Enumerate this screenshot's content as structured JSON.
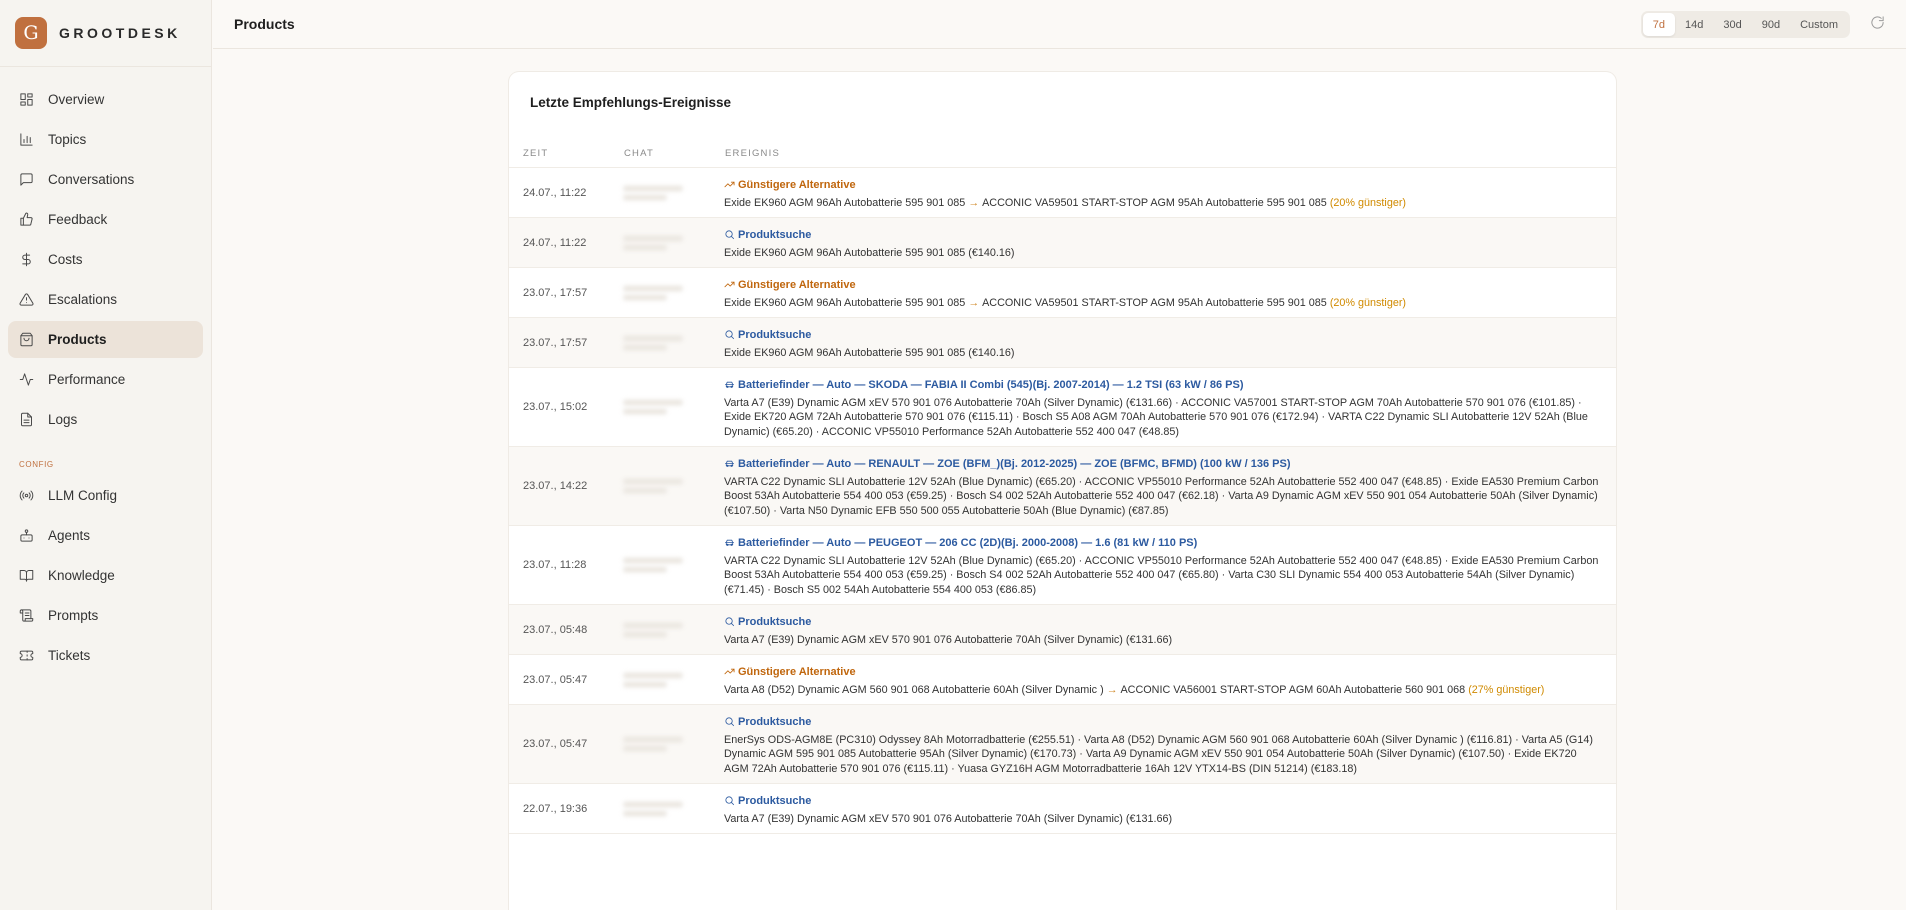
{
  "brand": {
    "logo_letter": "G",
    "name": "GROOTDESK"
  },
  "nav": {
    "items": [
      {
        "label": "Overview",
        "icon": "grid-icon",
        "active": false
      },
      {
        "label": "Topics",
        "icon": "bar-chart-icon",
        "active": false
      },
      {
        "label": "Conversations",
        "icon": "chat-bubble-icon",
        "active": false
      },
      {
        "label": "Feedback",
        "icon": "thumbs-up-icon",
        "active": false
      },
      {
        "label": "Costs",
        "icon": "dollar-icon",
        "active": false
      },
      {
        "label": "Escalations",
        "icon": "warning-icon",
        "active": false
      },
      {
        "label": "Products",
        "icon": "shopping-bag-icon",
        "active": true
      },
      {
        "label": "Performance",
        "icon": "activity-icon",
        "active": false
      },
      {
        "label": "Logs",
        "icon": "file-text-icon",
        "active": false
      }
    ],
    "config_label": "CONFIG",
    "config_items": [
      {
        "label": "LLM Config",
        "icon": "radio-icon"
      },
      {
        "label": "Agents",
        "icon": "bot-icon"
      },
      {
        "label": "Knowledge",
        "icon": "book-icon"
      },
      {
        "label": "Prompts",
        "icon": "scroll-icon"
      },
      {
        "label": "Tickets",
        "icon": "ticket-icon"
      }
    ]
  },
  "header": {
    "title": "Products",
    "ranges": [
      "7d",
      "14d",
      "30d",
      "90d",
      "Custom"
    ],
    "active_range": "7d",
    "refresh_icon": "refresh-icon"
  },
  "card": {
    "title": "Letzte Empfehlungs-Ereignisse",
    "columns": [
      "ZEIT",
      "CHAT",
      "EREIGNIS"
    ]
  },
  "colors": {
    "accent": "#c0703f",
    "alternative": "#c0660d",
    "search": "#2c5aa0",
    "savings": "#d08a00"
  },
  "events": [
    {
      "time": "24.07., 11:22",
      "type": "alt",
      "title": "Günstigere Alternative",
      "from": "Exide EK960 AGM 96Ah Autobatterie 595 901 085",
      "to": "ACCONIC VA59501 START-STOP AGM 95Ah Autobatterie 595 901 085",
      "savings": "(20% günstiger)"
    },
    {
      "time": "24.07., 11:22",
      "type": "search",
      "title": "Produktsuche",
      "detail": "Exide EK960 AGM 96Ah Autobatterie 595 901 085 (€140.16)"
    },
    {
      "time": "23.07., 17:57",
      "type": "alt",
      "title": "Günstigere Alternative",
      "from": "Exide EK960 AGM 96Ah Autobatterie 595 901 085",
      "to": "ACCONIC VA59501 START-STOP AGM 95Ah Autobatterie 595 901 085",
      "savings": "(20% günstiger)"
    },
    {
      "time": "23.07., 17:57",
      "type": "search",
      "title": "Produktsuche",
      "detail": "Exide EK960 AGM 96Ah Autobatterie 595 901 085 (€140.16)"
    },
    {
      "time": "23.07., 15:02",
      "type": "finder",
      "title": "Batteriefinder — Auto — SKODA — FABIA II Combi (545)(Bj. 2007-2014) — 1.2 TSI (63 kW / 86 PS)",
      "detail": "Varta A7 (E39) Dynamic AGM xEV 570 901 076 Autobatterie 70Ah (Silver Dynamic) (€131.66) · ACCONIC VA57001 START-STOP AGM 70Ah Autobatterie 570 901 076 (€101.85) · Exide EK720 AGM 72Ah Autobatterie 570 901 076 (€115.11) · Bosch S5 A08 AGM 70Ah Autobatterie 570 901 076 (€172.94) · VARTA C22 Dynamic SLI Autobatterie 12V 52Ah (Blue Dynamic) (€65.20) · ACCONIC VP55010 Performance 52Ah Autobatterie 552 400 047 (€48.85)"
    },
    {
      "time": "23.07., 14:22",
      "type": "finder",
      "title": "Batteriefinder — Auto — RENAULT — ZOE (BFM_)(Bj. 2012-2025) — ZOE (BFMC, BFMD) (100 kW / 136 PS)",
      "detail": "VARTA C22 Dynamic SLI Autobatterie 12V 52Ah (Blue Dynamic) (€65.20) · ACCONIC VP55010 Performance 52Ah Autobatterie 552 400 047 (€48.85) · Exide EA530 Premium Carbon Boost 53Ah Autobatterie 554 400 053 (€59.25) · Bosch S4 002 52Ah Autobatterie 552 400 047 (€62.18) · Varta A9 Dynamic AGM xEV 550 901 054 Autobatterie 50Ah (Silver Dynamic) (€107.50) · Varta N50 Dynamic EFB 550 500 055 Autobatterie 50Ah (Blue Dynamic) (€87.85)"
    },
    {
      "time": "23.07., 11:28",
      "type": "finder",
      "title": "Batteriefinder — Auto — PEUGEOT — 206 CC (2D)(Bj. 2000-2008) — 1.6 (81 kW / 110 PS)",
      "detail": "VARTA C22 Dynamic SLI Autobatterie 12V 52Ah (Blue Dynamic) (€65.20) · ACCONIC VP55010 Performance 52Ah Autobatterie 552 400 047 (€48.85) · Exide EA530 Premium Carbon Boost 53Ah Autobatterie 554 400 053 (€59.25) · Bosch S4 002 52Ah Autobatterie 552 400 047 (€65.80) · Varta C30 SLI Dynamic 554 400 053 Autobatterie 54Ah (Silver Dynamic) (€71.45) · Bosch S5 002 54Ah Autobatterie 554 400 053 (€86.85)"
    },
    {
      "time": "23.07., 05:48",
      "type": "search",
      "title": "Produktsuche",
      "detail": "Varta A7 (E39) Dynamic AGM xEV 570 901 076 Autobatterie 70Ah (Silver Dynamic) (€131.66)"
    },
    {
      "time": "23.07., 05:47",
      "type": "alt",
      "title": "Günstigere Alternative",
      "from": "Varta A8 (D52) Dynamic AGM 560 901 068 Autobatterie 60Ah (Silver Dynamic )",
      "to": "ACCONIC VA56001 START-STOP AGM 60Ah Autobatterie 560 901 068",
      "savings": "(27% günstiger)"
    },
    {
      "time": "23.07., 05:47",
      "type": "search",
      "title": "Produktsuche",
      "detail": "EnerSys ODS-AGM8E (PC310) Odyssey 8Ah Motorradbatterie (€255.51) · Varta A8 (D52) Dynamic AGM 560 901 068 Autobatterie 60Ah (Silver Dynamic ) (€116.81) · Varta A5 (G14) Dynamic AGM 595 901 085 Autobatterie 95Ah (Silver Dynamic) (€170.73) · Varta A9 Dynamic AGM xEV 550 901 054 Autobatterie 50Ah (Silver Dynamic) (€107.50) · Exide EK720 AGM 72Ah Autobatterie 570 901 076 (€115.11) · Yuasa GYZ16H AGM Motorradbatterie 16Ah 12V YTX14-BS (DIN 51214) (€183.18)"
    },
    {
      "time": "22.07., 19:36",
      "type": "search",
      "title": "Produktsuche",
      "detail": "Varta A7 (E39) Dynamic AGM xEV 570 901 076 Autobatterie 70Ah (Silver Dynamic) (€131.66)"
    }
  ]
}
